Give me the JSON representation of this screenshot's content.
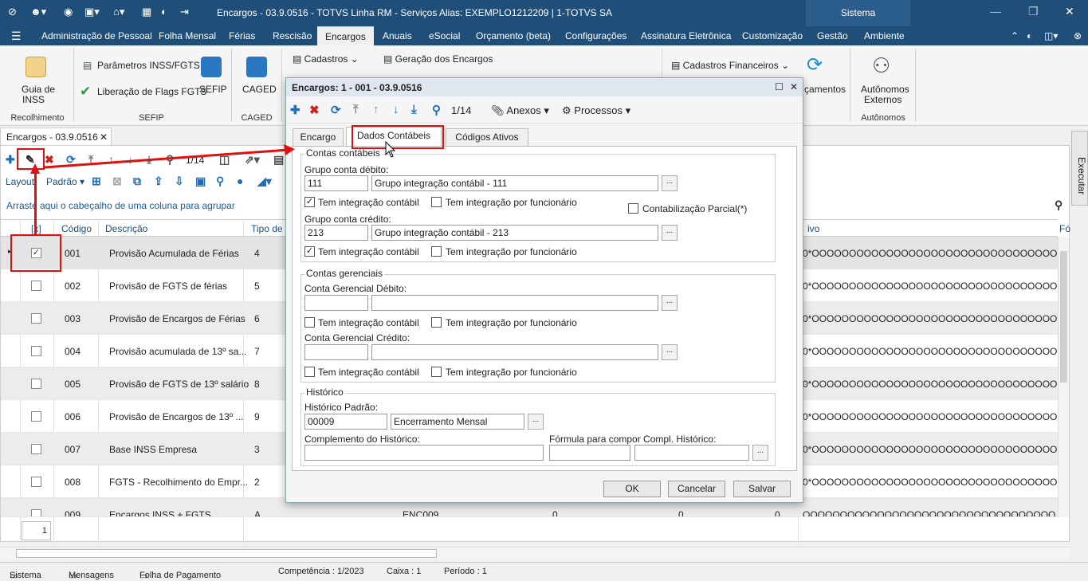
{
  "titlebar": {
    "title": "Encargos - 03.9.0516 - TOTVS Linha RM - Serviços  Alias: EXEMPLO1212209 | 1-TOTVS SA",
    "sistema": "Sistema"
  },
  "menu": [
    "Administração de Pessoal",
    "Folha Mensal",
    "Férias",
    "Rescisão",
    "Encargos",
    "Anuais",
    "eSocial",
    "Orçamento (beta)",
    "Configurações",
    "Assinatura Eletrônica",
    "Customização",
    "Gestão",
    "Ambiente"
  ],
  "ribbon": {
    "guia": "Guia de",
    "inss": "INSS",
    "recolhimento": "Recolhimento",
    "parametros": "Parâmetros INSS/FGTS",
    "liberacao": "Liberação de Flags FGTS",
    "sefip": "SEFIP",
    "sefip_group": "SEFIP",
    "caged": "CAGED",
    "caged_group": "CAGED",
    "cadastros": "Cadastros",
    "geracao": "Geração dos Encargos",
    "cadastros_fin": "Cadastros Financeiros",
    "orcamentos": "çamentos",
    "autonomos1": "Autônomos",
    "autonomos2": "Externos",
    "autonomos_group": "Autônomos"
  },
  "doc_tab": "Encargos - 03.9.0516",
  "grid_toolbar": {
    "counter": "1/14",
    "layout": "Layout",
    "padrao": "Padrão"
  },
  "group_hint": "Arraste aqui o cabeçalho de uma coluna para agrupar",
  "columns": {
    "sel": "[x]",
    "codigo": "Código",
    "descricao": "Descrição",
    "tipo": "Tipo de",
    "ativo": "ivo",
    "fo": "Fó"
  },
  "rows": [
    {
      "codigo": "001",
      "descricao": "Provisão Acumulada de Férias",
      "tipo": "4",
      "checked": "✓",
      "ativo": "0*OOOOOOOOOOOOOOOOOOOOOOOOOOOOOOOOO"
    },
    {
      "codigo": "002",
      "descricao": "Provisão de FGTS de férias",
      "tipo": "5",
      "checked": "",
      "ativo": "0*OOOOOOOOOOOOOOOOOOOOOOOOOOOOOOOOO"
    },
    {
      "codigo": "003",
      "descricao": "Provisão de Encargos de Férias",
      "tipo": "6",
      "checked": "",
      "ativo": "0*OOOOOOOOOOOOOOOOOOOOOOOOOOOOOOOOO"
    },
    {
      "codigo": "004",
      "descricao": "Provisão acumulada de 13º sa...",
      "tipo": "7",
      "checked": "",
      "ativo": "0*OOOOOOOOOOOOOOOOOOOOOOOOOOOOOOOOO"
    },
    {
      "codigo": "005",
      "descricao": "Provisão de FGTS de 13º salário",
      "tipo": "8",
      "checked": "",
      "ativo": "0*OOOOOOOOOOOOOOOOOOOOOOOOOOOOOOOOO"
    },
    {
      "codigo": "006",
      "descricao": "Provisão de Encargos de 13º ...",
      "tipo": "9",
      "checked": "",
      "ativo": "0*OOOOOOOOOOOOOOOOOOOOOOOOOOOOOOOOO"
    },
    {
      "codigo": "007",
      "descricao": "Base INSS Empresa",
      "tipo": "3",
      "checked": "",
      "ativo": "0*OOOOOOOOOOOOOOOOOOOOOOOOOOOOOOOOO"
    },
    {
      "codigo": "008",
      "descricao": "FGTS - Recolhimento do Empr...",
      "tipo": "2",
      "checked": "",
      "ativo": "0*OOOOOOOOOOOOOOOOOOOOOOOOOOOOOOOOO"
    },
    {
      "codigo": "009",
      "descricao": "Encargos  INSS + FGTS",
      "tipo": "A",
      "checked": "",
      "ativo": "OOOOOOOOOOOOOOOOOOOOOOOOOOOOOOOOOO",
      "extra1": "ENC009",
      "extra2": "0",
      "extra3": "0",
      "extra4": "0"
    }
  ],
  "pager": "1",
  "executar": "Executar",
  "statusbar": {
    "sistema": "Sistema",
    "mensagens": "Mensagens",
    "folha": "Folha de Pagamento",
    "competencia": "Competência : 1/2023",
    "caixa": "Caixa : 1",
    "periodo": "Período : 1"
  },
  "dialog": {
    "title": "Encargos: 1 - 001 - 03.9.0516",
    "counter": "1/14",
    "anexos": "Anexos",
    "processos": "Processos",
    "tabs": [
      "Encargo",
      "Dados Contábeis",
      "Códigos Ativos"
    ],
    "contas_contabeis": "Contas contábeis",
    "grupo_debito_lbl": "Grupo conta débito:",
    "grupo_debito_cod": "111",
    "grupo_debito_desc": "Grupo integração contábil - 111",
    "tem_integracao": "Tem integração contábil",
    "tem_integracao_func": "Tem integração por funcionário",
    "contab_parcial": "Contabilização Parcial(*)",
    "grupo_credito_lbl": "Grupo conta crédito:",
    "grupo_credito_cod": "213",
    "grupo_credito_desc": "Grupo integração contábil - 213",
    "contas_gerenciais": "Contas gerenciais",
    "ger_debito": "Conta Gerencial Débito:",
    "ger_credito": "Conta Gerencial Crédito:",
    "historico": "Histórico",
    "hist_padrao": "Histórico Padrão:",
    "hist_cod": "00009",
    "hist_desc": "Encerramento Mensal",
    "complemento": "Complemento do Histórico:",
    "formula": "Fórmula para compor Compl. Histórico:",
    "ok": "OK",
    "cancelar": "Cancelar",
    "salvar": "Salvar",
    "check": "✓"
  }
}
